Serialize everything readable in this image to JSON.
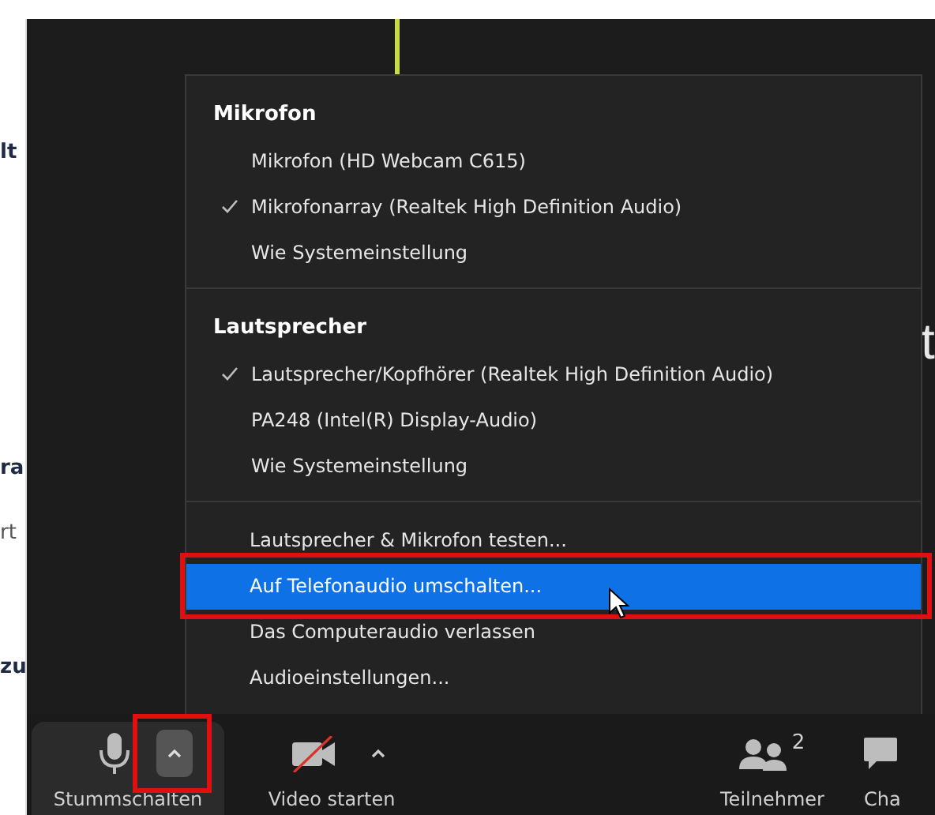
{
  "background_fragments": {
    "left_texts": [
      "lt",
      "ra",
      "rt",
      "zu"
    ],
    "right_text": "t"
  },
  "audio_menu": {
    "sections": [
      {
        "heading": "Mikrofon",
        "items": [
          {
            "label": "Mikrofon (HD Webcam C615)",
            "checked": false
          },
          {
            "label": "Mikrofonarray (Realtek High Definition Audio)",
            "checked": true
          },
          {
            "label": "Wie Systemeinstellung",
            "checked": false
          }
        ]
      },
      {
        "heading": "Lautsprecher",
        "items": [
          {
            "label": "Lautsprecher/Kopfhörer (Realtek High Definition Audio)",
            "checked": true
          },
          {
            "label": "PA248 (Intel(R) Display-Audio)",
            "checked": false
          },
          {
            "label": "Wie Systemeinstellung",
            "checked": false
          }
        ]
      }
    ],
    "actions": [
      {
        "label": "Lautsprecher & Mikrofon testen...",
        "selected": false,
        "framed": false
      },
      {
        "label": "Auf Telefonaudio umschalten...",
        "selected": true,
        "framed": true
      },
      {
        "label": "Das Computeraudio verlassen",
        "selected": false,
        "framed": false
      },
      {
        "label": "Audioeinstellungen...",
        "selected": false,
        "framed": false
      }
    ]
  },
  "toolbar": [
    {
      "kind": "mute",
      "label": "Stummschalten",
      "caret_framed": true
    },
    {
      "kind": "video",
      "label": "Video starten",
      "caret_framed": false
    },
    {
      "kind": "participants",
      "label": "Teilnehmer",
      "count": "2"
    },
    {
      "kind": "chat",
      "label": "Cha"
    }
  ]
}
